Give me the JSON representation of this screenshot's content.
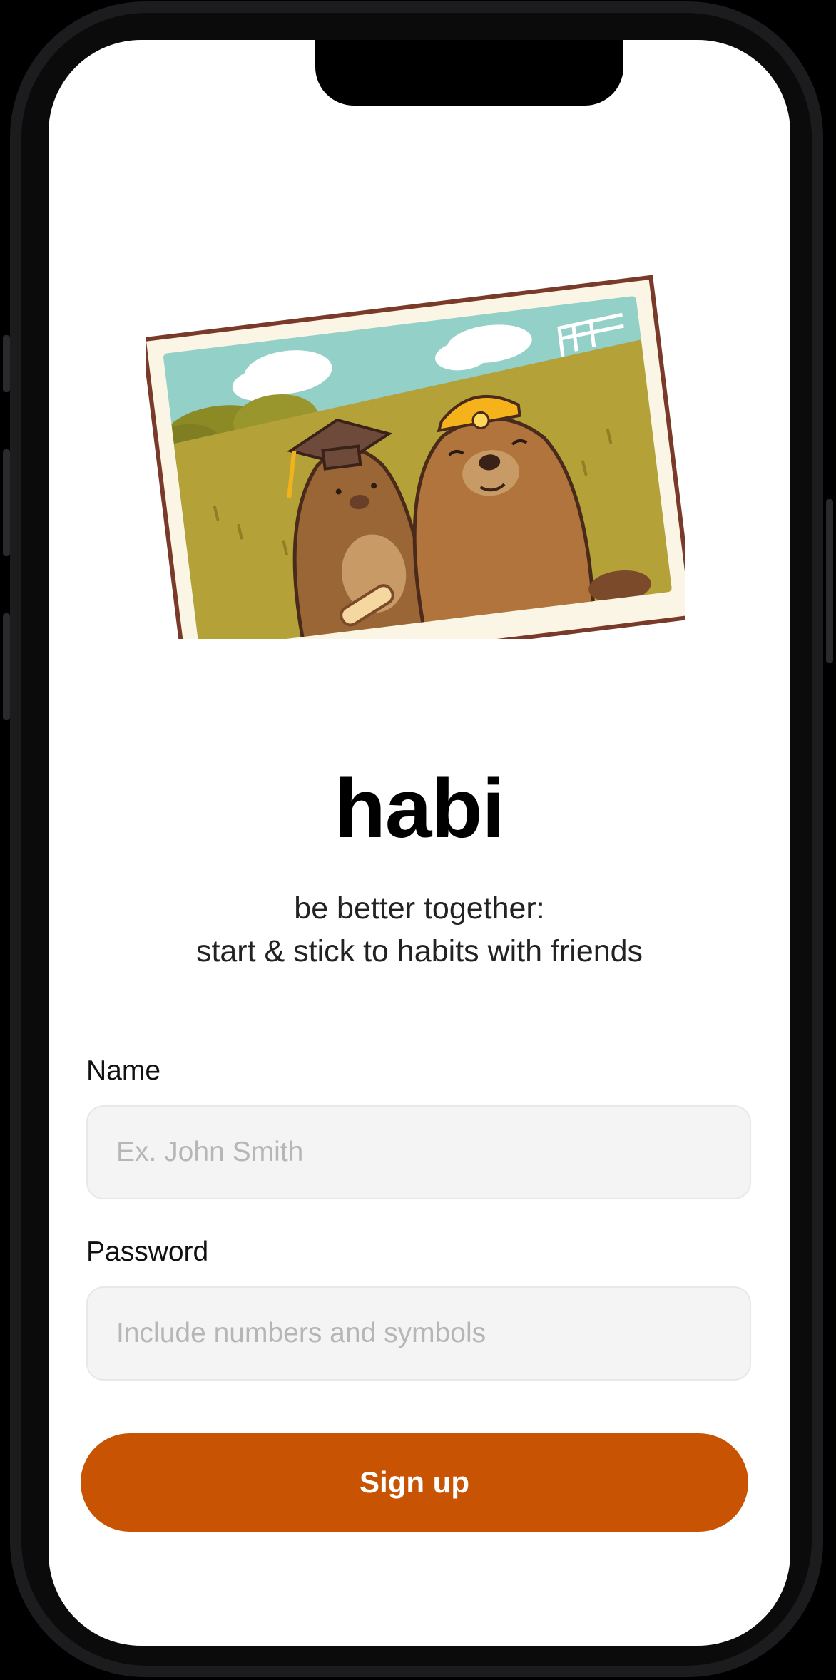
{
  "app": {
    "title": "habi",
    "tagline_line1": "be better together:",
    "tagline_line2": "start & stick to habits with friends"
  },
  "illustration": {
    "name": "beaver-friends-photo-icon"
  },
  "form": {
    "name_label": "Name",
    "name_placeholder": "Ex. John Smith",
    "password_label": "Password",
    "password_placeholder": "Include numbers and symbols",
    "submit_label": "Sign up"
  },
  "colors": {
    "accent": "#c75303",
    "input_bg": "#f4f4f4",
    "placeholder": "#b6b6b6"
  }
}
